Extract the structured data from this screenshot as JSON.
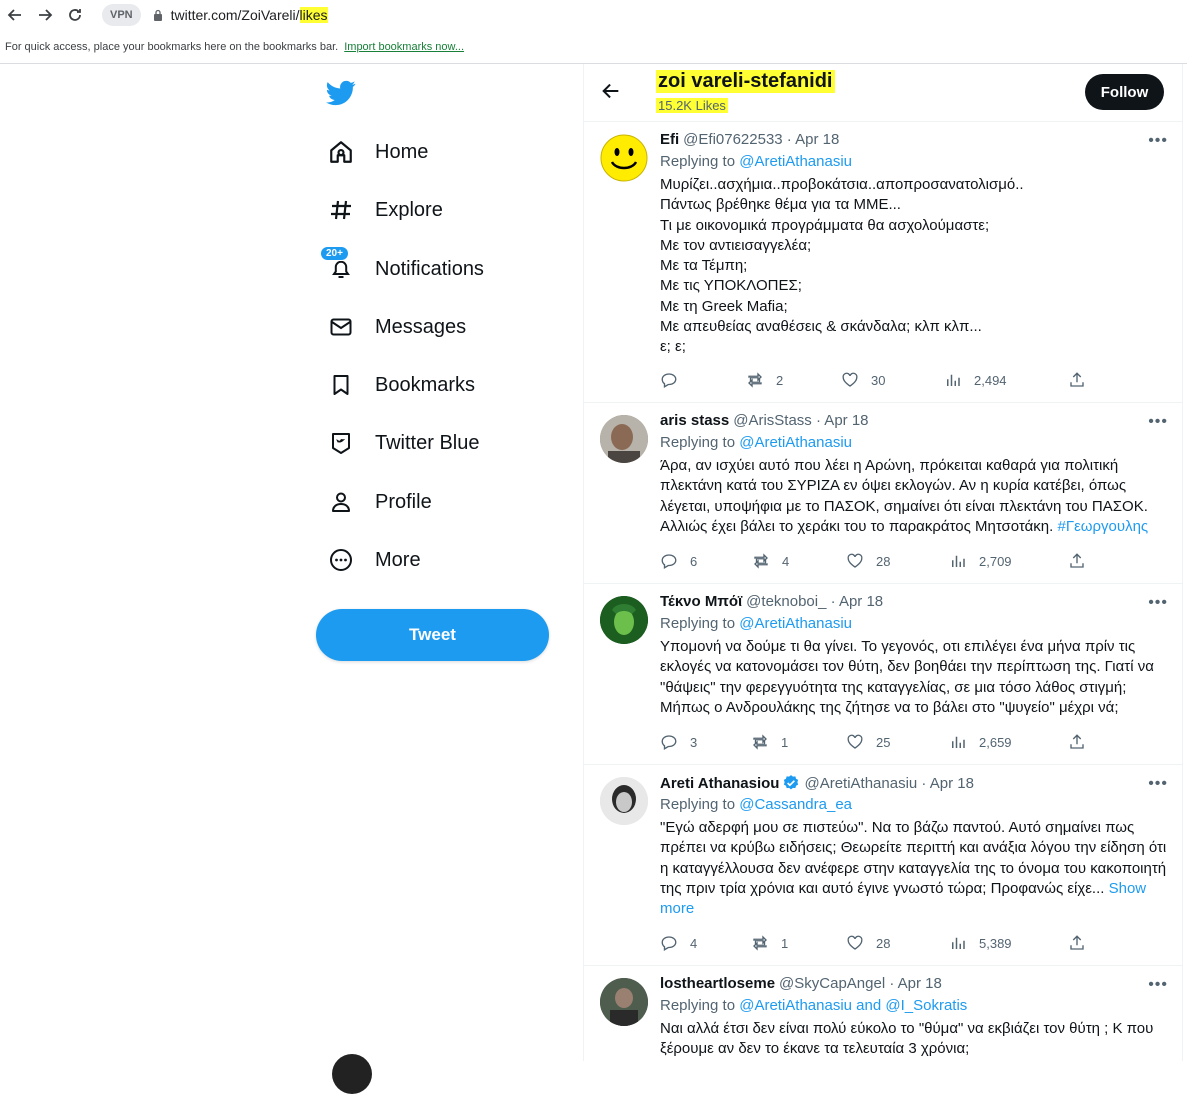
{
  "browser": {
    "vpn_label": "VPN",
    "url_base": "twitter.com/ZoiVareli/",
    "url_highlight": "likes",
    "bookmarks_text": "For quick access, place your bookmarks here on the bookmarks bar.",
    "bookmarks_link": "Import bookmarks now..."
  },
  "sidebar": {
    "items": [
      {
        "label": "Home",
        "icon": "home-icon"
      },
      {
        "label": "Explore",
        "icon": "hashtag-icon"
      },
      {
        "label": "Notifications",
        "icon": "bell-icon",
        "badge": "20+"
      },
      {
        "label": "Messages",
        "icon": "envelope-icon"
      },
      {
        "label": "Bookmarks",
        "icon": "bookmark-icon"
      },
      {
        "label": "Twitter Blue",
        "icon": "twitter-blue-icon"
      },
      {
        "label": "Profile",
        "icon": "person-icon"
      },
      {
        "label": "More",
        "icon": "more-circle-icon"
      }
    ],
    "tweet_button": "Tweet"
  },
  "header": {
    "name": "zoi vareli-stefanidi",
    "subtitle": "15.2K Likes",
    "follow": "Follow"
  },
  "tweets": [
    {
      "name": "Efi",
      "handle": "@Efi07622533 · Apr 18",
      "replying": "Replying to ",
      "mentions": "@AretiAthanasiu",
      "body": "Μυρίζει..ασχήμια..προβοκάτσια..αποπροσανατολισμό..\nΠάντως βρέθηκε θέμα για τα ΜΜΕ...\nΤι με οικονομικά προγράμματα θα ασχολούμαστε;\nΜε τον αντιεισαγγελέα;\nΜε τα Τέμπη;\nΜε τις ΥΠΟΚΛΟΠΕΣ;\nΜε τη Greek Mafia;\nΜε απευθείας αναθέσεις & σκάνδαλα; κλπ κλπ...\nε; ε;",
      "body_link": "",
      "replies": "",
      "retweets": "2",
      "likes": "30",
      "views": "2,494"
    },
    {
      "name": "aris stass",
      "handle": "@ArisStass · Apr 18",
      "replying": "Replying to ",
      "mentions": "@AretiAthanasiu",
      "body": "Άρα, αν ισχύει αυτό που λέει η Αρώνη, πρόκειται καθαρά για πολιτική πλεκτάνη κατά του ΣΥΡΙΖΑ εν όψει εκλογών. Αν η κυρία κατέβει, όπως λέγεται, υποψήφια με το ΠΑΣΟΚ, σημαίνει ότι είναι πλεκτάνη του ΠΑΣΟΚ. Αλλιώς έχει βάλει το χεράκι του το παρακράτος Μητσοτάκη. ",
      "body_link": "#Γεωργουλης",
      "replies": "6",
      "retweets": "4",
      "likes": "28",
      "views": "2,709"
    },
    {
      "name": "Τέκνο Μπόϊ",
      "handle": "@teknoboi_ · Apr 18",
      "replying": "Replying to ",
      "mentions": "@AretiAthanasiu",
      "body": "Υπομονή να δούμε τι θα γίνει. Το γεγονός, οτι επιλέγει ένα μήνα πρίν τις εκλογές να κατονομάσει τον θύτη, δεν βοηθάει την περίπτωση της. Γιατί να \"θάψεις\" την φερεγγυότητα της καταγγελίας, σε μια τόσο λάθος στιγμή; Μήπως ο Ανδρουλάκης της ζήτησε να το βάλει στο \"ψυγείο\" μέχρι νά;",
      "body_link": "",
      "replies": "3",
      "retweets": "1",
      "likes": "25",
      "views": "2,659"
    },
    {
      "name": "Areti Athanasiou",
      "handle": "@AretiAthanasiu · Apr 18",
      "replying": "Replying to ",
      "mentions": "@Cassandra_ea",
      "body": "\"Εγώ αδερφή μου σε πιστεύω\". Να το βάζω παντού. Αυτό σημαίνει πως πρέπει να κρύβω ειδήσεις; Θεωρείτε περιττή και ανάξια λόγου την είδηση ότι η καταγγέλλουσα  δεν ανέφερε στην καταγγελία της το όνομα του κακοποιητή της πριν τρία χρόνια και αυτό έγινε γνωστό τώρα; Προφανώς είχε... ",
      "body_link": "Show more",
      "replies": "4",
      "retweets": "1",
      "likes": "28",
      "views": "5,389"
    },
    {
      "name": "lostheartloseme",
      "handle": "@SkyCapAngel · Apr 18",
      "replying": "Replying to ",
      "mentions": "@AretiAthanasiu and @I_Sokratis",
      "body": "Ναι αλλά έτσι δεν είναι πολύ εύκολο το \"θύμα\" να εκβιάζει τον θύτη ; Κ που ξέρουμε αν δεν το έκανε τα τελευταία 3 χρόνια;",
      "body_link": "",
      "replies": "",
      "retweets": "",
      "likes": "",
      "views": ""
    }
  ],
  "colors": {
    "accent": "#1d9bf0",
    "text": "#0f1419",
    "muted": "#536471",
    "highlight": "#ffff33"
  }
}
